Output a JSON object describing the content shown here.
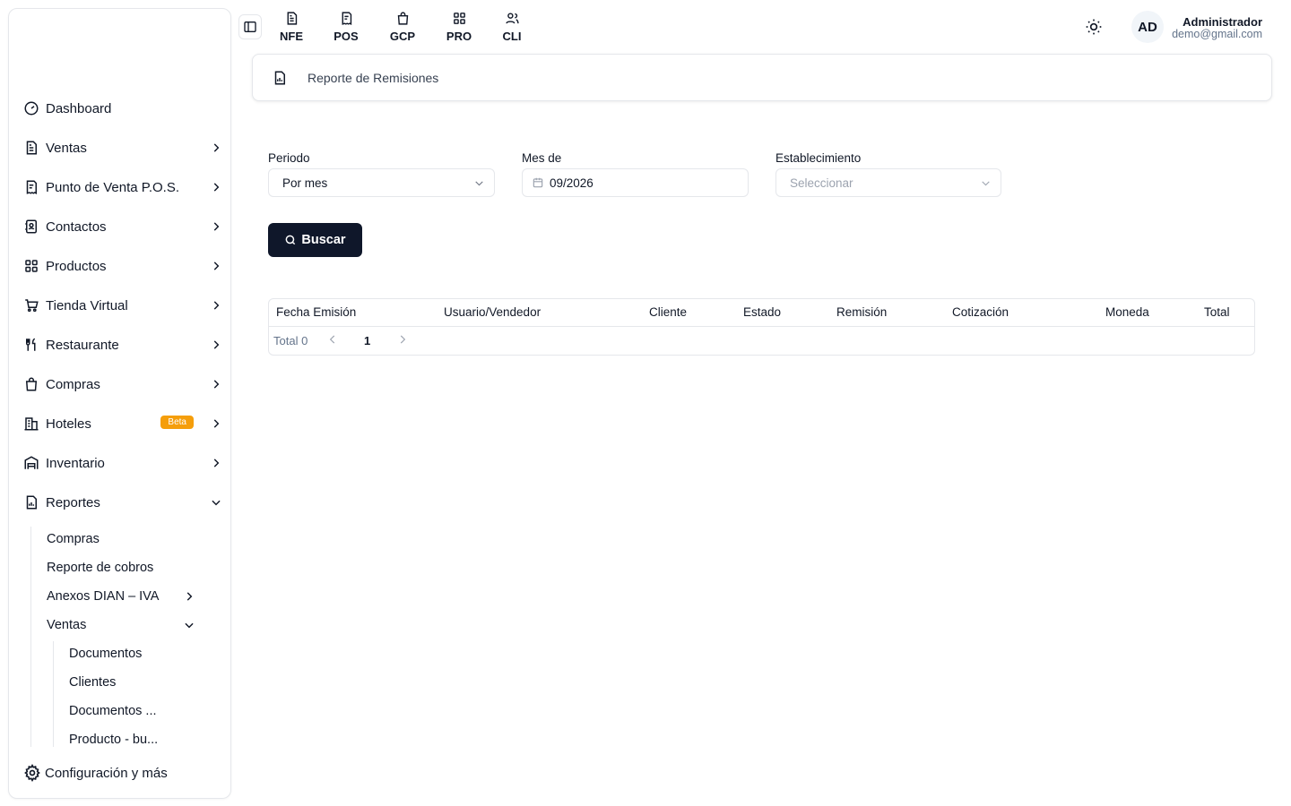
{
  "sidebar": {
    "items": [
      {
        "label": "Dashboard",
        "icon": "gauge-icon",
        "has_children": false
      },
      {
        "label": "Ventas",
        "icon": "document-icon",
        "has_children": true
      },
      {
        "label": "Punto de Venta P.O.S.",
        "icon": "receipt-icon",
        "has_children": true
      },
      {
        "label": "Contactos",
        "icon": "contacts-icon",
        "has_children": true
      },
      {
        "label": "Productos",
        "icon": "grid-icon",
        "has_children": true
      },
      {
        "label": "Tienda Virtual",
        "icon": "cart-icon",
        "has_children": true
      },
      {
        "label": "Restaurante",
        "icon": "utensils-icon",
        "has_children": true
      },
      {
        "label": "Compras",
        "icon": "shopping-bag-icon",
        "has_children": true
      },
      {
        "label": "Hoteles",
        "icon": "building-icon",
        "has_children": true,
        "badge": "Beta"
      },
      {
        "label": "Inventario",
        "icon": "warehouse-icon",
        "has_children": true
      },
      {
        "label": "Reportes",
        "icon": "report-icon",
        "has_children": true,
        "expanded": true
      }
    ],
    "reportes_sub": [
      {
        "label": "Compras"
      },
      {
        "label": "Reporte de cobros"
      },
      {
        "label": "Anexos DIAN – IVA"
      },
      {
        "label": "Ventas"
      }
    ],
    "ventas_sub": [
      {
        "label": "Documentos"
      },
      {
        "label": "Clientes"
      },
      {
        "label": "Documentos ..."
      },
      {
        "label": "Producto - bu..."
      }
    ],
    "settings_label": "Configuración y más"
  },
  "topbar": {
    "modules": [
      {
        "label": "NFE",
        "icon": "document-icon"
      },
      {
        "label": "POS",
        "icon": "receipt-icon"
      },
      {
        "label": "GCP",
        "icon": "shopping-bag-icon"
      },
      {
        "label": "PRO",
        "icon": "grid-icon"
      },
      {
        "label": "CLI",
        "icon": "users-icon"
      }
    ],
    "user": {
      "initials": "AD",
      "name": "Administrador",
      "email": "demo@gmail.com"
    }
  },
  "header": {
    "title": "Reporte de Remisiones"
  },
  "filters": {
    "periodo": {
      "label": "Periodo",
      "value": "Por mes"
    },
    "mes": {
      "label": "Mes de",
      "value": "09/2026"
    },
    "establecimiento": {
      "label": "Establecimiento",
      "placeholder": "Seleccionar"
    },
    "search_label": "Buscar"
  },
  "table": {
    "columns": [
      "Fecha Emisión",
      "Usuario/Vendedor",
      "Cliente",
      "Estado",
      "Remisión",
      "Cotización",
      "Moneda",
      "Total"
    ],
    "total_label": "Total 0",
    "current_page": "1"
  },
  "colors": {
    "primary": "#0f172a",
    "beta": "#f59e0b",
    "border": "#e5e7eb"
  }
}
